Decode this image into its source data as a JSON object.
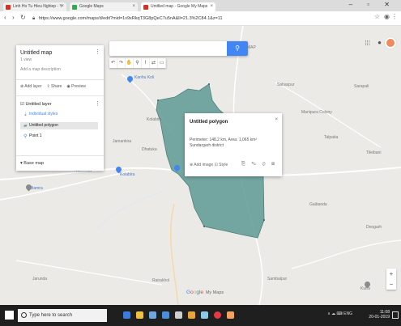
{
  "browser": {
    "tabs": [
      {
        "label": "Linh Ho Tu Hieu Nghiep - Y",
        "favicon_color": "#d93025"
      },
      {
        "label": "Google Maps",
        "favicon_color": "#34a853"
      },
      {
        "label": "Untitled map - Google My Maps",
        "favicon_color": "#d93025"
      }
    ],
    "window_controls": "– ▫ ✕",
    "url": "https://www.google.com/maps/d/edit?mid=1v9xRkqT3G8pQeC7u5nA&ll=21.3%2C84.1&z=11"
  },
  "map": {
    "search_placeholder": "",
    "tools": [
      "↶",
      "↷",
      "✋",
      "⚲",
      "⌇",
      "⇄",
      "▭"
    ],
    "colors": {
      "polygon_fill": "#5f9a94",
      "polygon_stroke": "#4a8079",
      "map_bg": "#eceae6",
      "road": "#ffffff",
      "accent": "#4285f4"
    },
    "place_labels": [
      {
        "text": "MAP",
        "style": "gray"
      },
      {
        "text": "Kanhu Koli",
        "style": "blue"
      },
      {
        "text": "Kolabira",
        "style": "gray"
      },
      {
        "text": "Sahaspur",
        "style": "gray"
      },
      {
        "text": "Manipura Colony",
        "style": "gray"
      },
      {
        "text": "Tileibani",
        "style": "gray"
      },
      {
        "text": "Talpatia",
        "style": "gray"
      },
      {
        "text": "Sarapali",
        "style": "gray"
      },
      {
        "text": "Dhatuka",
        "style": "gray"
      },
      {
        "text": "Jamankira",
        "style": "gray"
      },
      {
        "text": "Kuchinda",
        "style": "blue"
      },
      {
        "text": "Bamra",
        "style": "blue"
      },
      {
        "text": "Kolabira",
        "style": "blue"
      },
      {
        "text": "Gaibanda",
        "style": "gray"
      },
      {
        "text": "Jarunda",
        "style": "gray"
      },
      {
        "text": "Rairakhol",
        "style": "gray"
      },
      {
        "text": "Sambalpur",
        "style": "gray"
      },
      {
        "text": "Kutra",
        "style": "gray"
      },
      {
        "text": "Deogarh",
        "style": "gray"
      }
    ],
    "google_logo": {
      "letters": [
        "G",
        "o",
        "o",
        "g",
        "l",
        "e"
      ],
      "suffix": "My Maps"
    },
    "zoom": {
      "in": "+",
      "out": "−"
    }
  },
  "panel": {
    "title": "Untitled map",
    "subtitle": "1 view",
    "edit_text": "Add a map description",
    "actions": [
      "⊕ Add layer",
      "⇪ Share",
      "◉ Preview"
    ],
    "layer_title": "☑ Untitled layer",
    "layer_items": [
      {
        "icon": "⇣",
        "label": "Individual styles",
        "color": "#4285f4",
        "selected": false
      },
      {
        "icon": "▰",
        "label": "Untitled polygon",
        "color": "#5f9a94",
        "selected": true
      },
      {
        "icon": "⚲",
        "label": "Point 1",
        "color": "#4285f4",
        "selected": false
      }
    ],
    "basemap": "▾ Base map"
  },
  "card": {
    "title": "Untitled polygon",
    "description": "Perimeter: 148.2 km, Area: 1,065 km²",
    "description2": "Sundargarh district",
    "links": "⊕ Add image   ⊡ Style",
    "icons": "⎘ ✎ ⊘ ⊞"
  },
  "taskbar": {
    "search_label": "Type here to search",
    "icons": [
      {
        "name": "edge",
        "color": "#3b7ddd"
      },
      {
        "name": "file-explorer",
        "color": "#f0c040"
      },
      {
        "name": "store",
        "color": "#6fa8dc"
      },
      {
        "name": "mail",
        "color": "#4a90d9"
      },
      {
        "name": "photos",
        "color": "#cfcfcf"
      },
      {
        "name": "media",
        "color": "#e8a33d"
      },
      {
        "name": "settings",
        "color": "#8ecae6"
      },
      {
        "name": "opera",
        "color": "#e63946"
      },
      {
        "name": "app",
        "color": "#f4a261"
      }
    ],
    "tray": "∧  ☁  ⌨  ENG",
    "time": "11:08",
    "date": "20-01-2019"
  }
}
